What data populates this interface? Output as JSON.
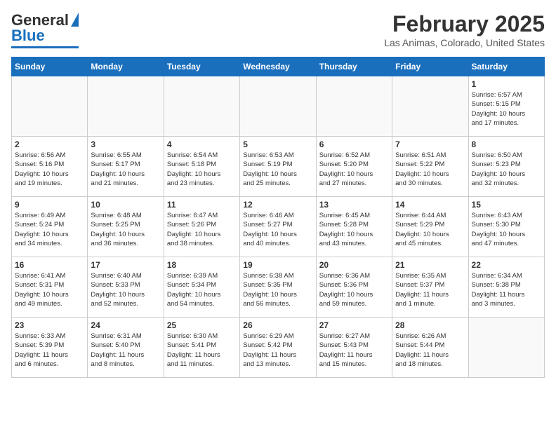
{
  "header": {
    "logo_line1": "General",
    "logo_line2": "Blue",
    "title": "February 2025",
    "subtitle": "Las Animas, Colorado, United States"
  },
  "weekdays": [
    "Sunday",
    "Monday",
    "Tuesday",
    "Wednesday",
    "Thursday",
    "Friday",
    "Saturday"
  ],
  "weeks": [
    [
      {
        "day": "",
        "info": ""
      },
      {
        "day": "",
        "info": ""
      },
      {
        "day": "",
        "info": ""
      },
      {
        "day": "",
        "info": ""
      },
      {
        "day": "",
        "info": ""
      },
      {
        "day": "",
        "info": ""
      },
      {
        "day": "1",
        "info": "Sunrise: 6:57 AM\nSunset: 5:15 PM\nDaylight: 10 hours\nand 17 minutes."
      }
    ],
    [
      {
        "day": "2",
        "info": "Sunrise: 6:56 AM\nSunset: 5:16 PM\nDaylight: 10 hours\nand 19 minutes."
      },
      {
        "day": "3",
        "info": "Sunrise: 6:55 AM\nSunset: 5:17 PM\nDaylight: 10 hours\nand 21 minutes."
      },
      {
        "day": "4",
        "info": "Sunrise: 6:54 AM\nSunset: 5:18 PM\nDaylight: 10 hours\nand 23 minutes."
      },
      {
        "day": "5",
        "info": "Sunrise: 6:53 AM\nSunset: 5:19 PM\nDaylight: 10 hours\nand 25 minutes."
      },
      {
        "day": "6",
        "info": "Sunrise: 6:52 AM\nSunset: 5:20 PM\nDaylight: 10 hours\nand 27 minutes."
      },
      {
        "day": "7",
        "info": "Sunrise: 6:51 AM\nSunset: 5:22 PM\nDaylight: 10 hours\nand 30 minutes."
      },
      {
        "day": "8",
        "info": "Sunrise: 6:50 AM\nSunset: 5:23 PM\nDaylight: 10 hours\nand 32 minutes."
      }
    ],
    [
      {
        "day": "9",
        "info": "Sunrise: 6:49 AM\nSunset: 5:24 PM\nDaylight: 10 hours\nand 34 minutes."
      },
      {
        "day": "10",
        "info": "Sunrise: 6:48 AM\nSunset: 5:25 PM\nDaylight: 10 hours\nand 36 minutes."
      },
      {
        "day": "11",
        "info": "Sunrise: 6:47 AM\nSunset: 5:26 PM\nDaylight: 10 hours\nand 38 minutes."
      },
      {
        "day": "12",
        "info": "Sunrise: 6:46 AM\nSunset: 5:27 PM\nDaylight: 10 hours\nand 40 minutes."
      },
      {
        "day": "13",
        "info": "Sunrise: 6:45 AM\nSunset: 5:28 PM\nDaylight: 10 hours\nand 43 minutes."
      },
      {
        "day": "14",
        "info": "Sunrise: 6:44 AM\nSunset: 5:29 PM\nDaylight: 10 hours\nand 45 minutes."
      },
      {
        "day": "15",
        "info": "Sunrise: 6:43 AM\nSunset: 5:30 PM\nDaylight: 10 hours\nand 47 minutes."
      }
    ],
    [
      {
        "day": "16",
        "info": "Sunrise: 6:41 AM\nSunset: 5:31 PM\nDaylight: 10 hours\nand 49 minutes."
      },
      {
        "day": "17",
        "info": "Sunrise: 6:40 AM\nSunset: 5:33 PM\nDaylight: 10 hours\nand 52 minutes."
      },
      {
        "day": "18",
        "info": "Sunrise: 6:39 AM\nSunset: 5:34 PM\nDaylight: 10 hours\nand 54 minutes."
      },
      {
        "day": "19",
        "info": "Sunrise: 6:38 AM\nSunset: 5:35 PM\nDaylight: 10 hours\nand 56 minutes."
      },
      {
        "day": "20",
        "info": "Sunrise: 6:36 AM\nSunset: 5:36 PM\nDaylight: 10 hours\nand 59 minutes."
      },
      {
        "day": "21",
        "info": "Sunrise: 6:35 AM\nSunset: 5:37 PM\nDaylight: 11 hours\nand 1 minute."
      },
      {
        "day": "22",
        "info": "Sunrise: 6:34 AM\nSunset: 5:38 PM\nDaylight: 11 hours\nand 3 minutes."
      }
    ],
    [
      {
        "day": "23",
        "info": "Sunrise: 6:33 AM\nSunset: 5:39 PM\nDaylight: 11 hours\nand 6 minutes."
      },
      {
        "day": "24",
        "info": "Sunrise: 6:31 AM\nSunset: 5:40 PM\nDaylight: 11 hours\nand 8 minutes."
      },
      {
        "day": "25",
        "info": "Sunrise: 6:30 AM\nSunset: 5:41 PM\nDaylight: 11 hours\nand 11 minutes."
      },
      {
        "day": "26",
        "info": "Sunrise: 6:29 AM\nSunset: 5:42 PM\nDaylight: 11 hours\nand 13 minutes."
      },
      {
        "day": "27",
        "info": "Sunrise: 6:27 AM\nSunset: 5:43 PM\nDaylight: 11 hours\nand 15 minutes."
      },
      {
        "day": "28",
        "info": "Sunrise: 6:26 AM\nSunset: 5:44 PM\nDaylight: 11 hours\nand 18 minutes."
      },
      {
        "day": "",
        "info": ""
      }
    ]
  ]
}
